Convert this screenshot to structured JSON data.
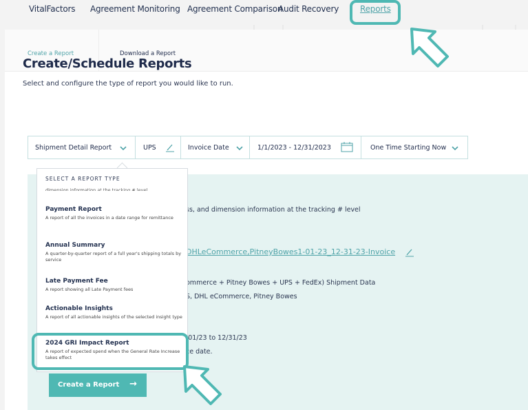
{
  "topnav": {
    "items": [
      "VitalFactors",
      "Agreement Monitoring",
      "Agreement Comparison",
      "Audit Recovery",
      "Reports"
    ]
  },
  "tabs": {
    "create": "Create a Report",
    "download": "Download a Report"
  },
  "page": {
    "title": "Create/Schedule Reports",
    "subtitle": "Select and configure the type of report you would like to run."
  },
  "filters": {
    "report_type": "Shipment Detail Report",
    "carrier": "UPS",
    "date_field": "Invoice Date",
    "date_range": "1/1/2023 - 12/31/2023",
    "schedule": "One Time Starting Now"
  },
  "summary": {
    "desc_partial": "ss, and dimension information at the tracking # level",
    "filename_partial": "DHLeCommerce,PitneyBowes1-01-23_12-31-23-Invoice",
    "data_partial": "ommerce + Pitney Bowes + UPS + FedEx) Shipment Data",
    "carriers_partial": "S, DHL eCommerce, Pitney Bowes",
    "range_partial": "/01/23 to 12/31/23",
    "date_partial": "ce date."
  },
  "dropdown": {
    "header": "SELECT A REPORT TYPE",
    "cut_text": "dimension information at the tracking # level",
    "items": [
      {
        "name": "Payment Report",
        "desc": "A report of all the invoices in a date range for remittance"
      },
      {
        "name": "Annual Summary",
        "desc": "A quarter-by-quarter report of a full year's shipping totals by service"
      },
      {
        "name": "Late Payment Fee",
        "desc": "A report showing all Late Payment fees"
      },
      {
        "name": "Actionable Insights",
        "desc": "A report of all actionable insights of the selected insight type"
      },
      {
        "name": "2024 GRI Impact Report",
        "desc": "A report of expected spend when the General Rate Increase takes effect"
      }
    ]
  },
  "button": {
    "create_label": "Create a Report",
    "arrow": "→"
  },
  "colors": {
    "accent": "#4fb8b3",
    "link": "#4fa3a8",
    "panel_bg": "#e5f3f2",
    "text": "#1e2a4a"
  }
}
